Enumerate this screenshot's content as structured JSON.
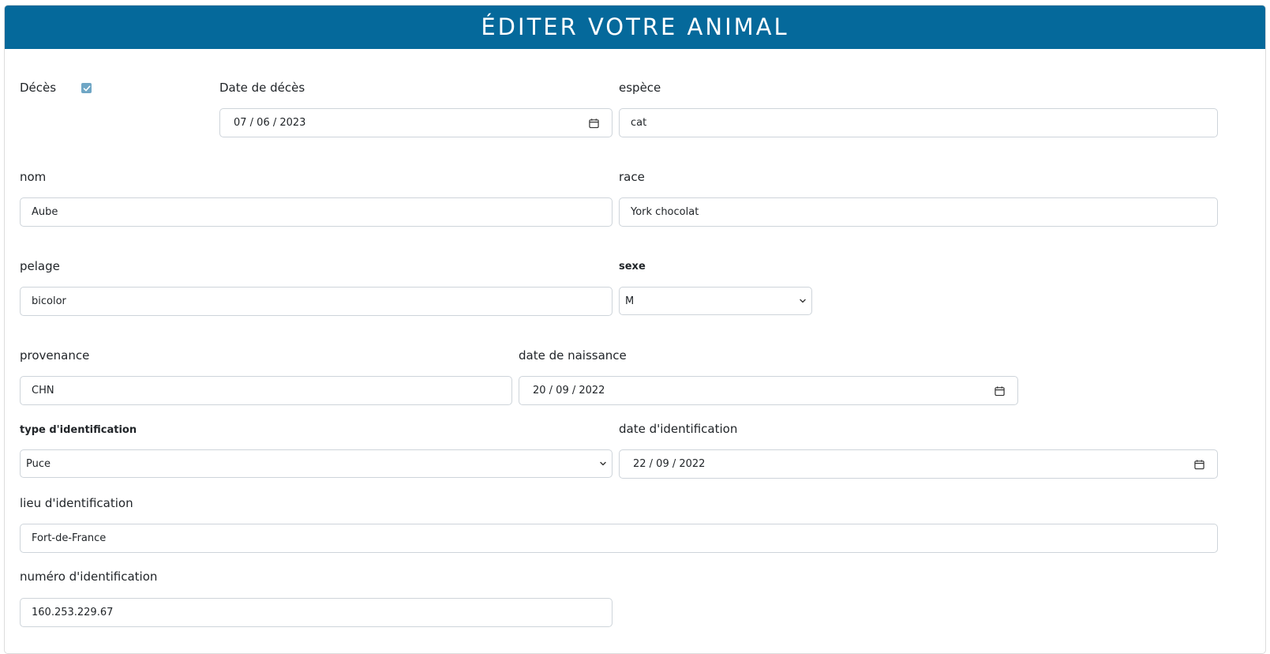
{
  "header": {
    "title": "ÉDITER VOTRE ANIMAL"
  },
  "deces": {
    "label": "Décès",
    "checked": true
  },
  "date_deces": {
    "label": "Date de décès",
    "value": "07 / 06 / 2023"
  },
  "espece": {
    "label": "espèce",
    "value": "cat"
  },
  "nom": {
    "label": "nom",
    "value": "Aube"
  },
  "race": {
    "label": "race",
    "value": "York chocolat"
  },
  "pelage": {
    "label": "pelage",
    "value": "bicolor"
  },
  "sexe": {
    "label": "sexe",
    "value": "M"
  },
  "provenance": {
    "label": "provenance",
    "value": "CHN"
  },
  "date_naissance": {
    "label": "date de naissance",
    "value": "20 / 09 / 2022"
  },
  "type_identification": {
    "label": "type d'identification",
    "value": "Puce"
  },
  "date_identification": {
    "label": "date d'identification",
    "value": "22 / 09 / 2022"
  },
  "lieu_identification": {
    "label": "lieu d'identification",
    "value": "Fort-de-France"
  },
  "numero_identification": {
    "label": "numéro d'identification",
    "value": "160.253.229.67"
  },
  "colors": {
    "header_bg": "#05699b",
    "checkbox": "#6fa6c5",
    "border": "#ced4da"
  }
}
